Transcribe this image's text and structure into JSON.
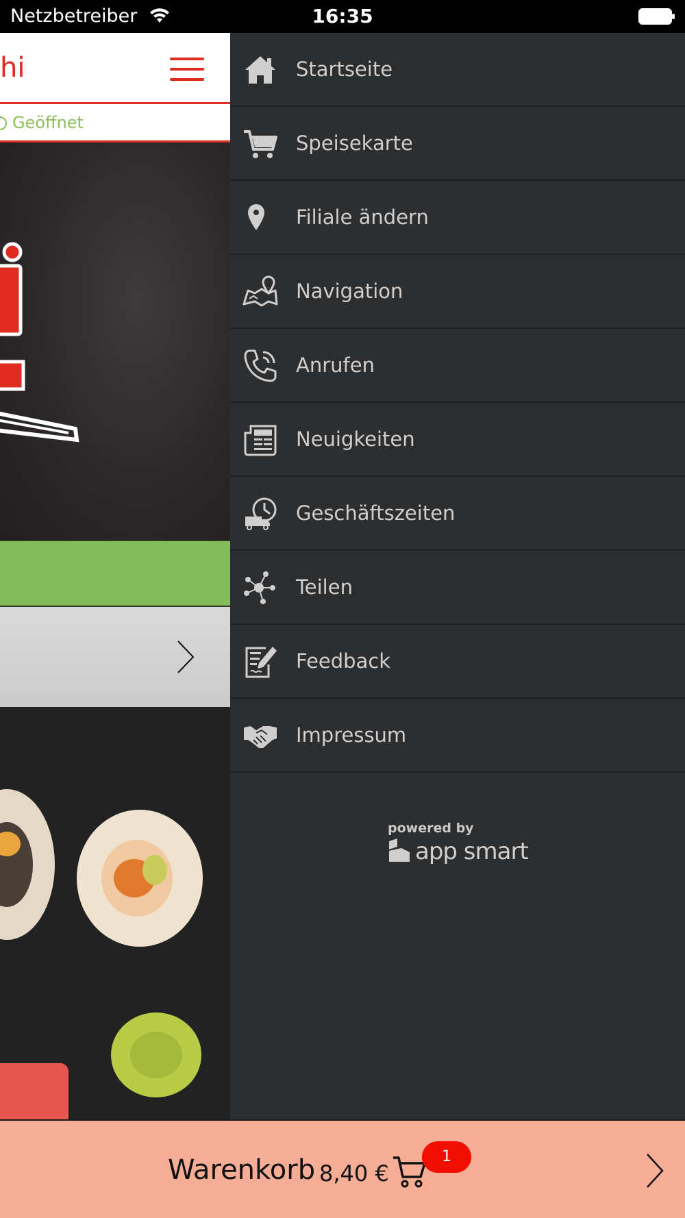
{
  "status_bar": {
    "carrier": "Netzbetreiber",
    "time": "16:35"
  },
  "app": {
    "brand_fragment": "hi",
    "status_text": "Geöffnet"
  },
  "menu": {
    "items": [
      {
        "label": "Startseite",
        "icon": "home-icon"
      },
      {
        "label": "Speisekarte",
        "icon": "cart-icon"
      },
      {
        "label": "Filiale ändern",
        "icon": "location-pin-icon"
      },
      {
        "label": "Navigation",
        "icon": "map-icon"
      },
      {
        "label": "Anrufen",
        "icon": "phone-icon"
      },
      {
        "label": "Neuigkeiten",
        "icon": "news-icon"
      },
      {
        "label": "Geschäftszeiten",
        "icon": "delivery-clock-icon"
      },
      {
        "label": "Teilen",
        "icon": "share-icon"
      },
      {
        "label": "Feedback",
        "icon": "feedback-icon"
      },
      {
        "label": "Impressum",
        "icon": "handshake-icon"
      }
    ],
    "powered_by": "powered by",
    "powered_brand": "app smart"
  },
  "cart": {
    "label": "Warenkorb",
    "amount": "8,40 €",
    "count": "1"
  },
  "colors": {
    "accent_red": "#e02b20",
    "open_green": "#8cbf5a",
    "drawer_bg": "#2d2e30",
    "cart_bg": "#f5ad96",
    "badge_red": "#f10e00"
  }
}
